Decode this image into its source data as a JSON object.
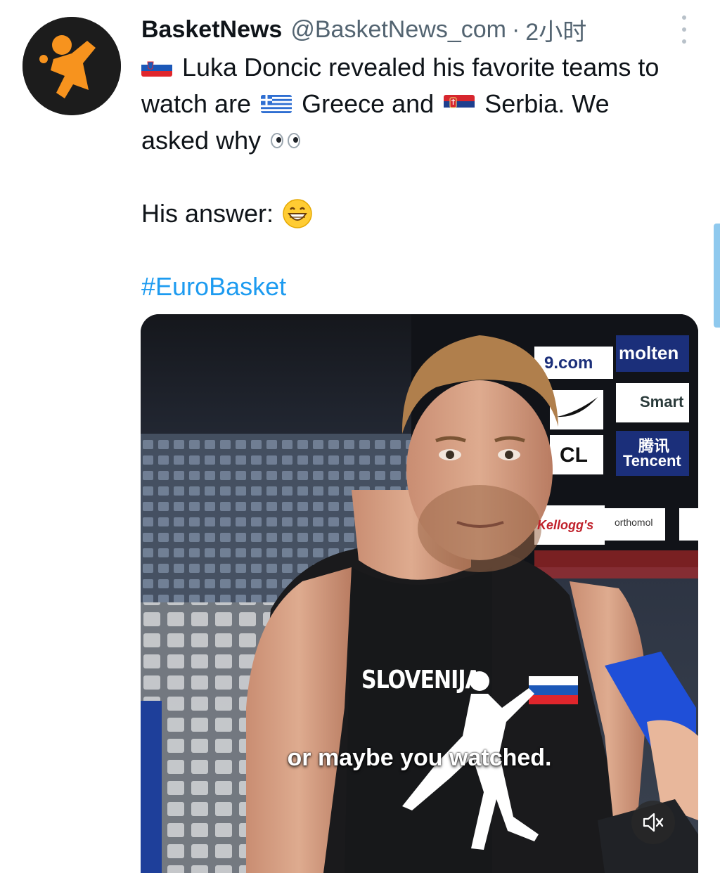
{
  "tweet": {
    "display_name": "BasketNews",
    "handle": "@BasketNews_com",
    "separator": "·",
    "time": "2小时",
    "text_lines": {
      "line1": "Luka Doncic revealed his favorite teams to",
      "line2_a": "watch are",
      "line2_b": "Greece and",
      "line2_c": "Serbia. We",
      "line3": "asked why",
      "line4": "His answer:"
    },
    "hashtag": "#EuroBasket"
  },
  "media": {
    "caption": "or maybe you watched.",
    "jersey_text": "SLOVENIJA",
    "sponsors": {
      "s1": "9.com",
      "s2": "molten",
      "s3": "Smart",
      "s4": "CL",
      "s5": "腾讯",
      "s6": "Tencent",
      "s7": "Kellogg's",
      "s8": "orthomol"
    }
  },
  "icons": {
    "avatar": "basketnews-logo-icon",
    "more": "more-vertical-icon",
    "mute": "speaker-muted-icon",
    "flag_slovenia": "slovenia-flag-icon",
    "flag_greece": "greece-flag-icon",
    "flag_serbia": "serbia-flag-icon",
    "eyes": "eyes-emoji-icon",
    "grin": "grinning-face-emoji-icon"
  },
  "colors": {
    "link": "#1d9bf0",
    "logo_orange": "#f7931e",
    "secondary_text": "#536471"
  }
}
